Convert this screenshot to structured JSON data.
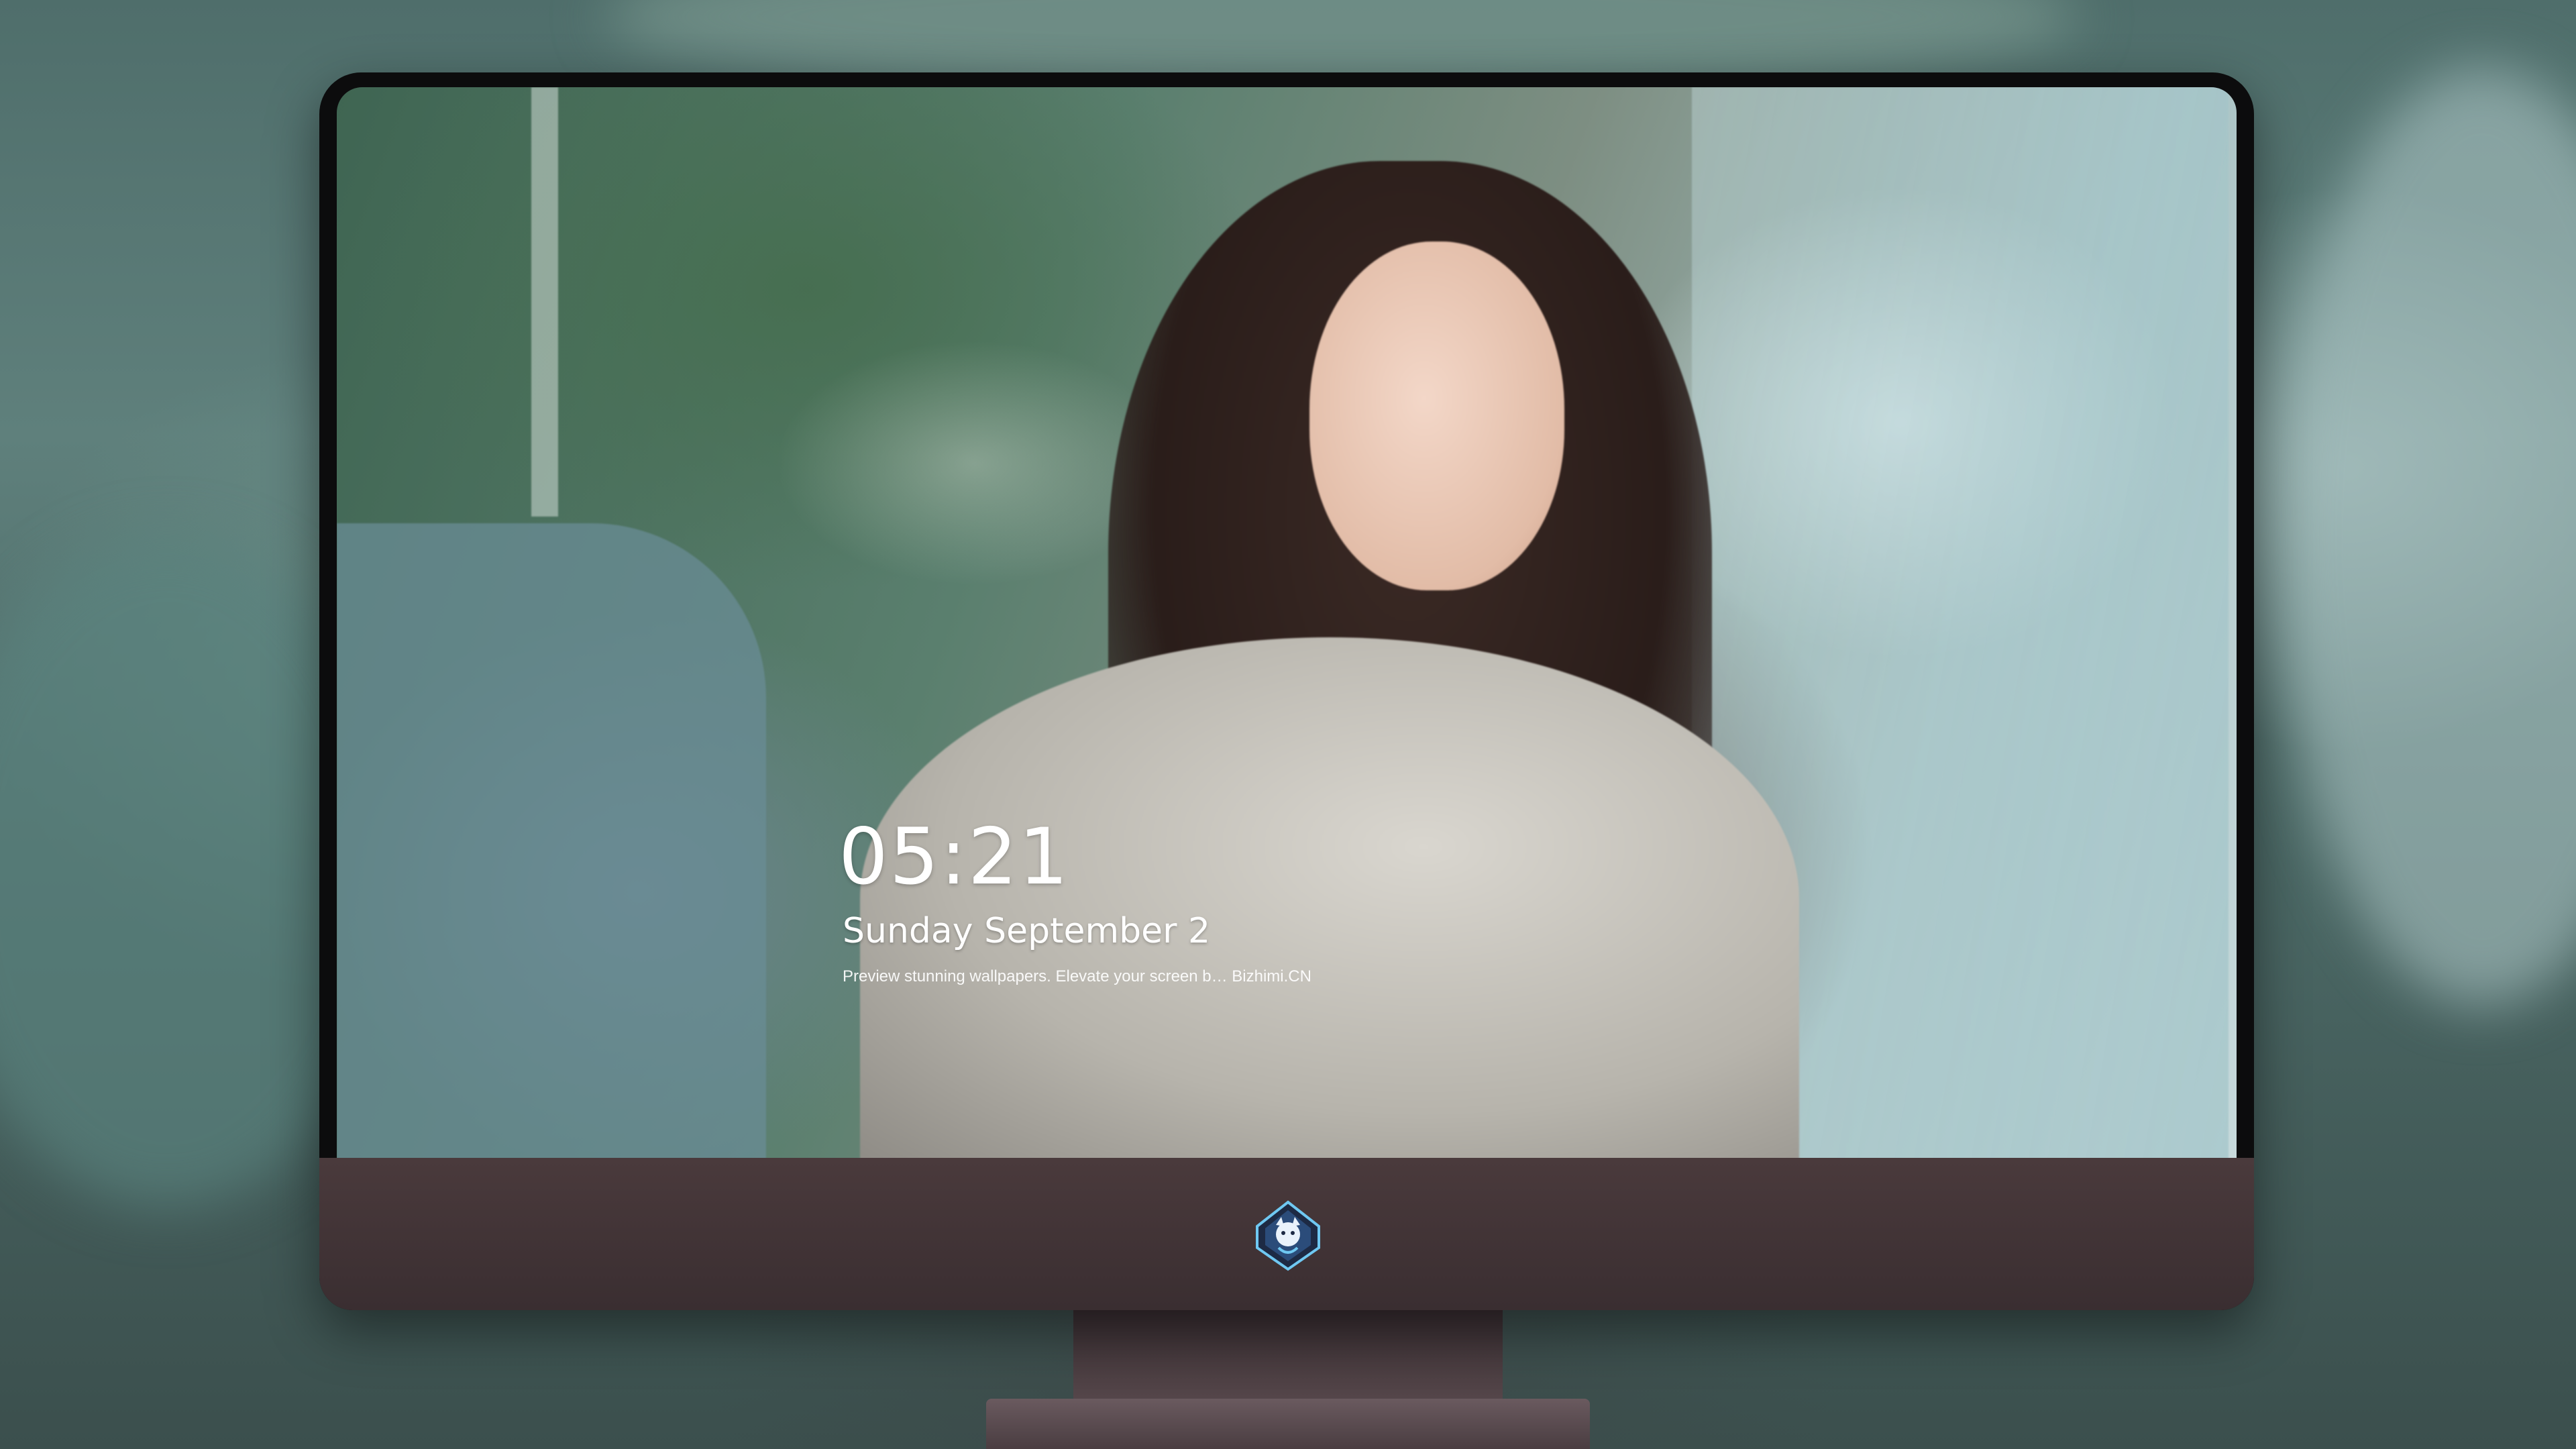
{
  "lockscreen": {
    "time": "05:21",
    "date": "Sunday September  2",
    "tagline": "Preview stunning wallpapers. Elevate your screen b… Bizhimi.CN"
  },
  "dock": {
    "items": [
      {
        "name": "messages-icon",
        "color": "#34c759"
      },
      {
        "name": "weather-icon",
        "color": "#2f8ff0"
      },
      {
        "name": "clock-icon",
        "color": "#ffffff"
      },
      {
        "name": "preview-icon",
        "color": "#e8e4d4"
      },
      {
        "name": "clips-icon",
        "color": "#39c1e6"
      },
      {
        "name": "notes-icon",
        "color": "#f6e17a"
      },
      {
        "name": "photo-booth-icon",
        "color": "#f4b34a"
      },
      {
        "name": "music-icon",
        "color": "#f23bb0"
      },
      {
        "name": "app-store-icon",
        "color": "#1a8cf5"
      },
      {
        "name": "camera-icon",
        "color": "#6a6a6e"
      }
    ]
  },
  "branding": {
    "chin_logo": "dragon-logo-icon"
  }
}
